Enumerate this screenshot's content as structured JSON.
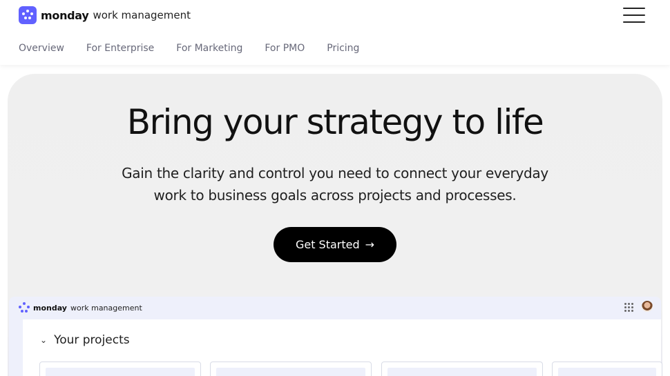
{
  "header": {
    "brand": "monday",
    "brand_rest": "work management",
    "menu_icon": "hamburger-menu-icon"
  },
  "nav": {
    "items": [
      {
        "label": "Overview"
      },
      {
        "label": "For Enterprise"
      },
      {
        "label": "For Marketing"
      },
      {
        "label": "For PMO"
      },
      {
        "label": "Pricing"
      }
    ]
  },
  "hero": {
    "title": "Bring your strategy to life",
    "subtitle": "Gain the clarity and control you need to connect your everyday work to business goals across projects and processes.",
    "cta_label": "Get Started",
    "cta_icon": "arrow-right-icon"
  },
  "preview": {
    "brand": "monday",
    "brand_rest": "work management",
    "section_title": "Your projects",
    "icons": [
      "apps-grid-icon",
      "user-avatar"
    ]
  },
  "colors": {
    "accent": "#6161ff",
    "cta_bg": "#000000",
    "hero_bg": "#efefef",
    "preview_bar": "#eef0fb",
    "nav_text": "#676879"
  }
}
